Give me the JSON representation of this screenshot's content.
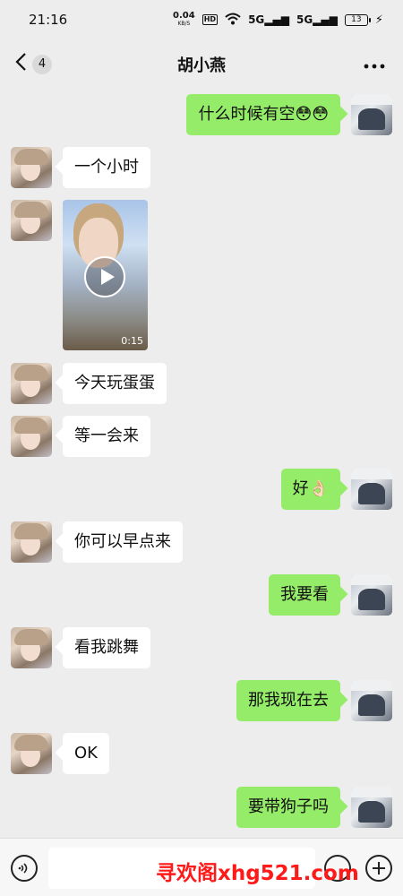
{
  "status_bar": {
    "time": "21:16",
    "net_speed": "0.04",
    "net_unit": "KB/S",
    "hd_badge": "HD",
    "wifi_icon": "wifi-icon",
    "signal1": "5G",
    "signal2": "5G",
    "battery": "13"
  },
  "nav": {
    "back_icon": "chevron-left-icon",
    "unread_count": "4",
    "title": "胡小燕",
    "more_icon": "more-dots-icon"
  },
  "messages": [
    {
      "side": "me",
      "text": "什么时候有空😳😳"
    },
    {
      "side": "her",
      "text": "一个小时"
    },
    {
      "side": "her",
      "type": "video",
      "duration": "0:15"
    },
    {
      "side": "her",
      "text": "今天玩蛋蛋"
    },
    {
      "side": "her",
      "text": "等一会来"
    },
    {
      "side": "me",
      "text": "好👌🏻"
    },
    {
      "side": "her",
      "text": "你可以早点来"
    },
    {
      "side": "me",
      "text": "我要看"
    },
    {
      "side": "her",
      "text": "看我跳舞"
    },
    {
      "side": "me",
      "text": "那我现在去"
    },
    {
      "side": "her",
      "text": "OK"
    },
    {
      "side": "me",
      "text": "要带狗子吗"
    }
  ],
  "input_bar": {
    "voice_icon": "voice-icon",
    "input_value": "",
    "emoji_icon": "emoji-icon",
    "plus_icon": "plus-icon"
  },
  "watermark": "寻欢阁xhg521.com",
  "colors": {
    "background": "#ededed",
    "my_bubble": "#95ec69",
    "her_bubble": "#ffffff",
    "watermark": "#ff1a1a"
  }
}
